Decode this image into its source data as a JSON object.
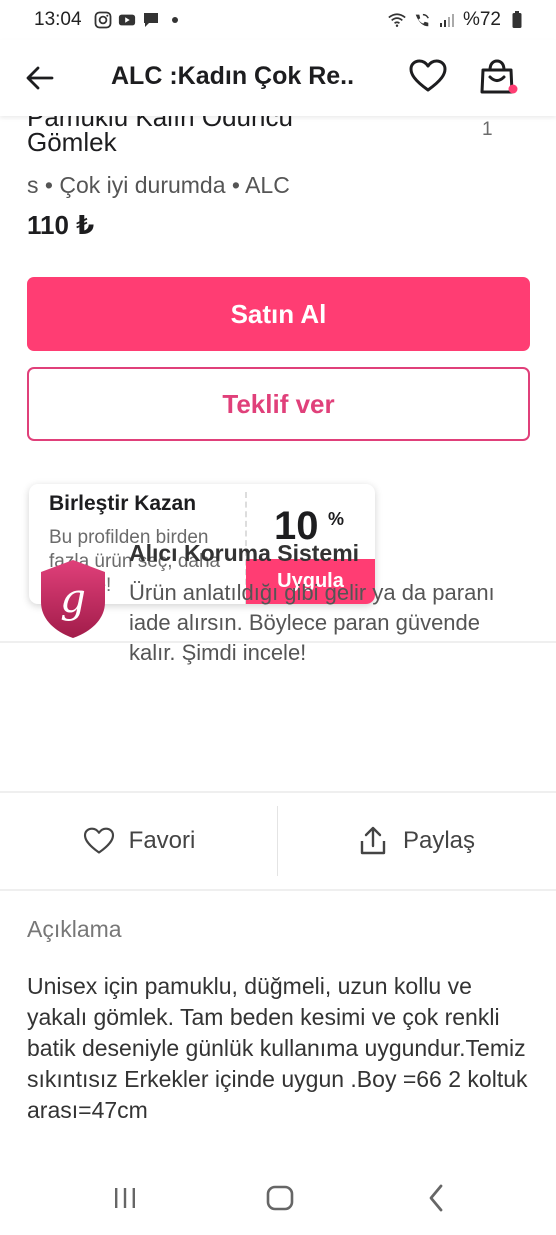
{
  "status_bar": {
    "time": "13:04",
    "battery": "%72",
    "icons_left": [
      "instagram-icon",
      "youtube-icon",
      "message-icon",
      "dot-icon"
    ],
    "icons_right": [
      "wifi-icon",
      "wifi-call-icon",
      "signal-icon",
      "battery-icon"
    ]
  },
  "header": {
    "title": "ALC :Kadın Çok Re..",
    "icons": [
      "back-arrow-icon",
      "heart-icon",
      "shopping-bag-icon"
    ]
  },
  "product": {
    "title_cut": "Pamuklu Kalın Oduncu",
    "title_line2": "Gömlek",
    "image_counter": "1",
    "meta": "s • Çok iyi durumda • ALC",
    "price": "110 ₺"
  },
  "buttons": {
    "buy": "Satın Al",
    "offer": "Teklif ver"
  },
  "combine": {
    "title": "Birleştir Kazan",
    "description": "Bu profilden birden fazla ürün seç, daha az öde!",
    "discount_value": "10",
    "discount_unit": "%",
    "apply": "Uygula"
  },
  "protection": {
    "title": "Alıcı Koruma Sistemi",
    "description": "Ürün anlatıldığı gibi gelir ya da paranı iade alırsın. Böylece paran güvende kalır. Şimdi incele!",
    "logo_letter": "g"
  },
  "actions": {
    "favorite": "Favori",
    "share": "Paylaş"
  },
  "description": {
    "heading": "Açıklama",
    "text": "Unisex  için pamuklu, düğmeli, uzun kollu ve yakalı gömlek.  Tam beden  kesimi ve çok renkli batik deseniyle günlük kullanıma uygundur.Temiz sıkıntısız Erkekler içinde uygun .Boy =66 2 koltuk arası=47cm"
  },
  "colors": {
    "accent": "#ff3d73",
    "accent_text": "#e0407a",
    "shield_top": "#e0407a",
    "shield_bottom": "#a21c4a"
  }
}
